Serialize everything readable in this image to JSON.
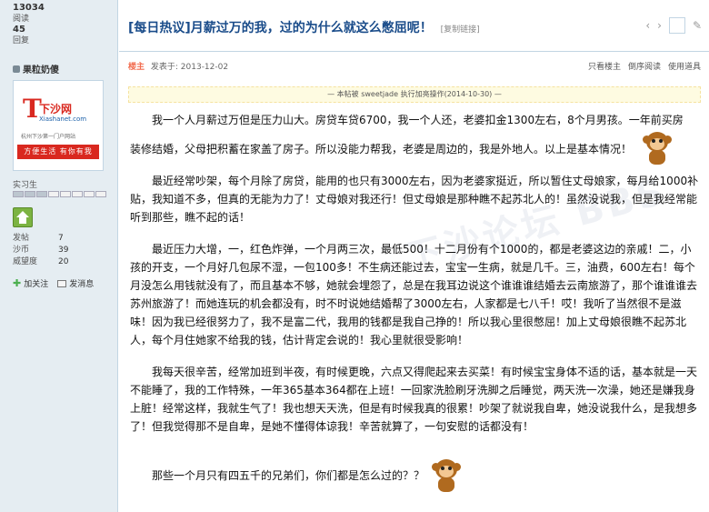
{
  "user": {
    "stat_top": [
      {
        "value": "13034",
        "label": "阅读"
      },
      {
        "value": "45",
        "label": "回复"
      }
    ],
    "name": "果粒奶傻",
    "avatar": {
      "logo_text": "下沙网",
      "logo_url": "Xiashanet.com",
      "sub": "杭州下沙第一门户网站",
      "banner": "方便生活 有你有我"
    },
    "rank_label": "实习生",
    "rank_level": 3,
    "rank_total": 8,
    "stats": [
      {
        "label": "发帖",
        "value": "7"
      },
      {
        "label": "沙币",
        "value": "39"
      },
      {
        "label": "威望度",
        "value": "20"
      }
    ],
    "add_friend": "加关注",
    "send_msg": "发消息"
  },
  "thread": {
    "title": "[每日热议]月薪过万的我，过的为什么就这么憋屈呢！",
    "copy_link": "[复制链接]"
  },
  "post": {
    "louzhu": "楼主",
    "posted_at": "发表于: 2013-12-02",
    "actions": [
      "只看楼主",
      "倒序阅读",
      "使用道具"
    ],
    "notice": "— 本帖被 sweetjade 执行加亮操作(2014-10-30) —",
    "paragraphs": [
      "我一个人月薪过万但是压力山大。房贷车贷6700，我一个人还，老婆扣金1300左右，8个月男孩。一年前买房",
      "装修结婚，父母把积蓄在家盖了房子。所以没能力帮我，老婆是周边的，我是外地人。以上是基本情况！",
      "最近经常吵架，每个月除了房贷，能用的也只有3000左右，因为老婆家挺近，所以暂住丈母娘家，每月给1000补贴，我知道不多，但真的无能为力了！丈母娘对我还行！但丈母娘是那种瞧不起苏北人的！虽然没说我，但是我经常能听到那些，瞧不起的话！",
      "最近压力大增，一，红色炸弹，一个月两三次，最低500！十二月份有个1000的，都是老婆这边的亲戚！二，小孩的开支，一个月好几包尿不湿，一包100多！不生病还能过去，宝宝一生病，就是几千。三，油费，600左右！每个月没怎么用钱就没有了，而且基本不够，她就会埋怨了，总是在我耳边说这个谁谁谁结婚去云南旅游了，那个谁谁谁去苏州旅游了！而她连玩的机会都没有，时不时说她结婚帮了3000左右，人家都是七八千！哎！我听了当然很不是滋味！因为我已经很努力了，我不是富二代，我用的钱都是我自己挣的！所以我心里很憋屈！加上丈母娘很瞧不起苏北人，每个月住她家不给我的钱，估计背定会说的！我心里就很受影响！",
      "我每天很辛苦，经常加班到半夜，有时候更晚，六点又得爬起来去买菜！有时候宝宝身体不适的话，基本就是一天不能睡了，我的工作特殊，一年365基本364都在上班！一回家洗脸刷牙洗脚之后睡觉，两天洗一次澡，她还是嫌我身上脏！经常这样，我就生气了！我也想天天洗，但是有时候我真的很累！吵架了就说我自卑，她没说我什么，是我想多了！但我觉得那不是自卑，是她不懂得体谅我！辛苦就算了，一句安慰的话都没有！",
      "那些一个月只有四五千的兄弟们，你们都是怎么过的？？"
    ]
  },
  "watermark": "下沙论坛 BBS"
}
